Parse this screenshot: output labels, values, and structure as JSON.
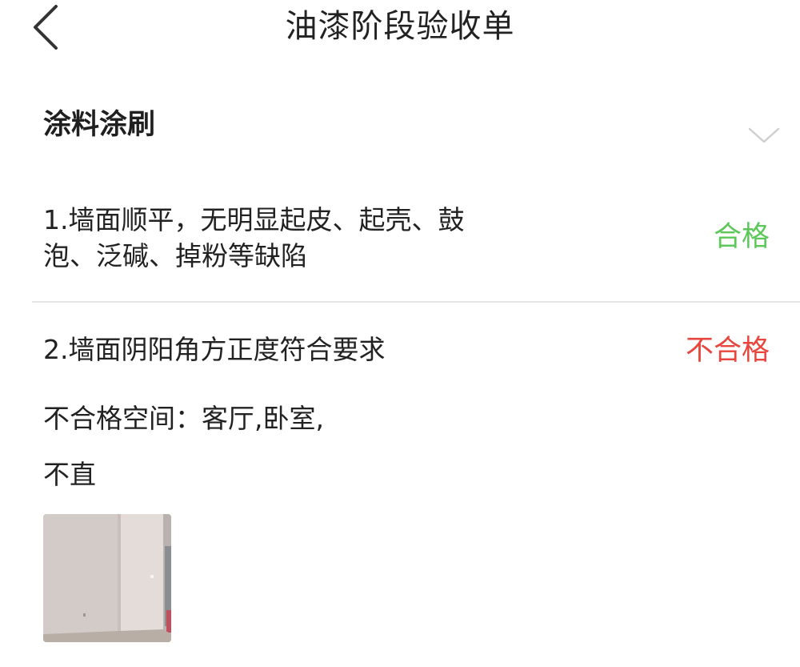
{
  "nav": {
    "title": "油漆阶段验收单",
    "back_icon": "chevron-left-icon"
  },
  "section": {
    "title": "涂料涂刷",
    "toggle_icon": "chevron-down-icon"
  },
  "items": [
    {
      "text_line1": "1.墙面顺平，无明显起皮、起壳、鼓",
      "text_line2": "泡、泛碱、掉粉等缺陷",
      "result": "合格",
      "result_color": "#5cc85a"
    },
    {
      "text": "2.墙面阴阳角方正度符合要求",
      "result": "不合格",
      "result_color": "#e8453c",
      "failed_spaces": "不合格空间：客厅,卧室,",
      "remark": "不直",
      "photo_icon": "room-photo-thumbnail"
    }
  ]
}
